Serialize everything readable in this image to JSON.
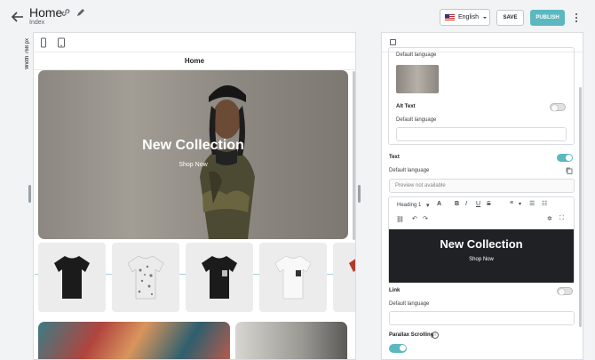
{
  "header": {
    "title": "Home",
    "subtitle": "Index",
    "language": "English",
    "save_label": "SAVE",
    "publish_label": "PUBLISH",
    "publish_color": "#5bb8c0"
  },
  "canvas": {
    "width_label": "Width 768 px",
    "page_title": "Home",
    "hero": {
      "title": "New Collection",
      "cta": "Shop Now"
    },
    "products": [
      {
        "color": "#1b1b1b",
        "pattern": "plain"
      },
      {
        "color": "#e9e9e9",
        "pattern": "floral"
      },
      {
        "color": "#1b1b1b",
        "pattern": "pocket"
      },
      {
        "color": "#f7f7f7",
        "pattern": "pocket-dark"
      },
      {
        "color": "#b33a2b",
        "pattern": "plain"
      }
    ]
  },
  "panel": {
    "image_section": {
      "default_language_label": "Default language",
      "alt_text_label": "Alt Text",
      "alt_default_language_label": "Default language",
      "alt_text_value": ""
    },
    "text_section": {
      "label": "Text",
      "default_language_label": "Default language",
      "preview_placeholder": "Preview not available",
      "heading_select": "Heading 1",
      "preview_title": "New Collection",
      "preview_cta": "Shop Now"
    },
    "link_section": {
      "label": "Link",
      "default_language_label": "Default language",
      "value": ""
    },
    "parallax_section": {
      "label": "Parallax Scrolling"
    }
  }
}
